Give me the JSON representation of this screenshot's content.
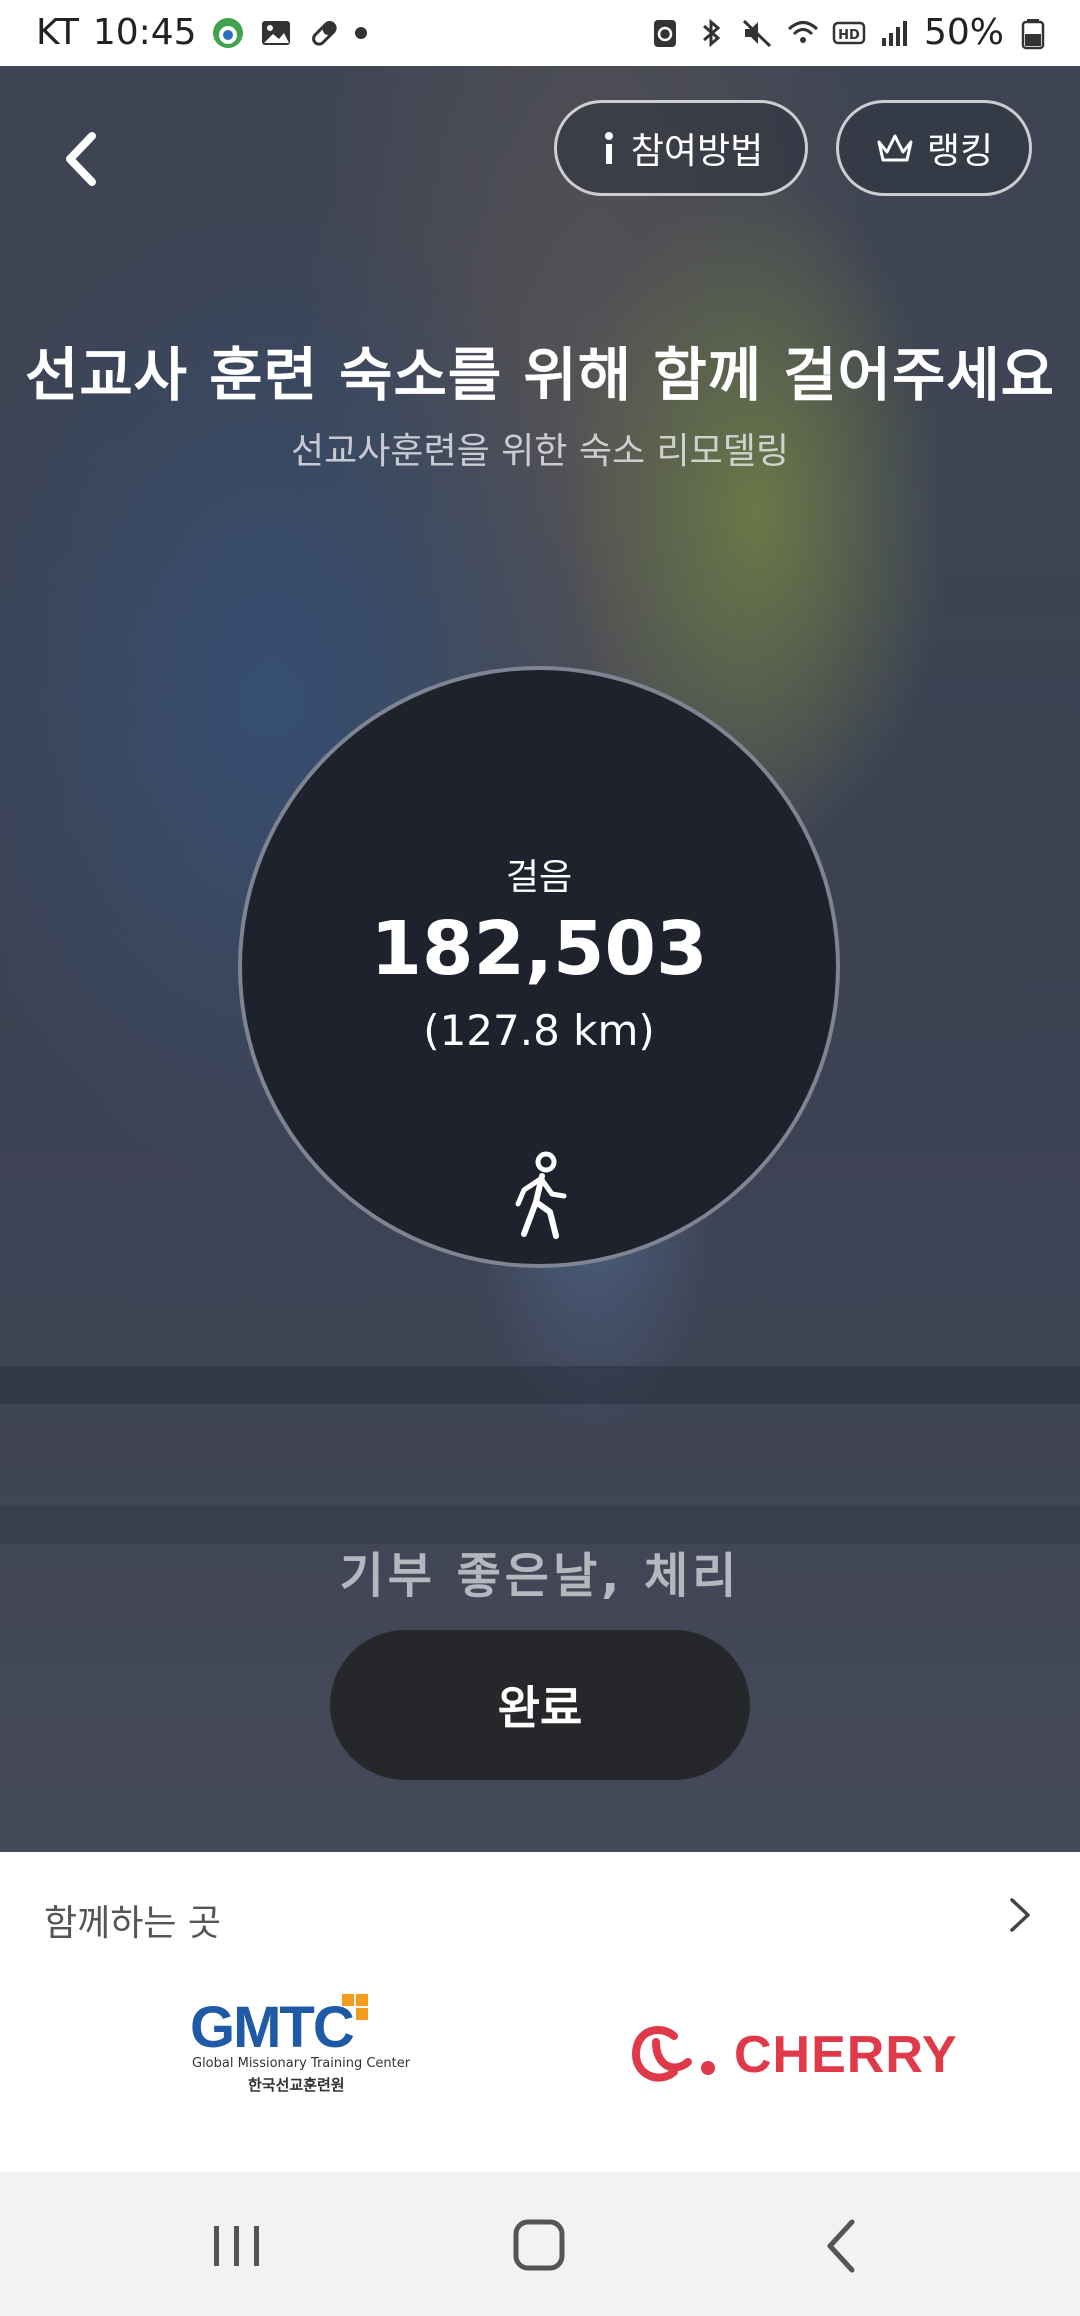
{
  "status_bar": {
    "carrier": "KT",
    "time": "10:45",
    "battery": "50%"
  },
  "header": {
    "how_to_label": "참여방법",
    "ranking_label": "랭킹"
  },
  "campaign": {
    "title": "선교사 훈련 숙소를 위해 함께 걸어주세요",
    "subtitle": "선교사훈련을 위한 숙소 리모델링"
  },
  "counter": {
    "label": "걸음",
    "steps": "182,503",
    "distance": "(127.8 km)"
  },
  "sponsor_text": "기부 좋은날, 체리",
  "done_label": "완료",
  "partners": {
    "title": "함께하는 곳",
    "gmtc_logo": "GMTC",
    "gmtc_sub": "Global Missionary Training Center",
    "gmtc_korean": "한국선교훈련원",
    "cherry_logo": "CHERRY"
  },
  "colors": {
    "circle_bg": "#1d222c",
    "button_bg": "#25272b",
    "cherry_red": "#e0394a",
    "gmtc_blue": "#1f5aa6"
  }
}
